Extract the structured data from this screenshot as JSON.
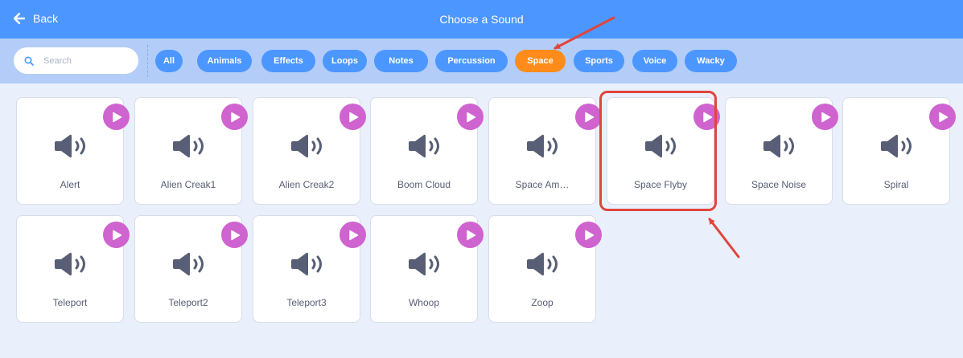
{
  "header": {
    "back_label": "Back",
    "title": "Choose a Sound"
  },
  "search": {
    "placeholder": "Search",
    "value": ""
  },
  "tags": [
    {
      "label": "All",
      "active": false
    },
    {
      "label": "Animals",
      "active": false
    },
    {
      "label": "Effects",
      "active": false
    },
    {
      "label": "Loops",
      "active": false
    },
    {
      "label": "Notes",
      "active": false
    },
    {
      "label": "Percussion",
      "active": false
    },
    {
      "label": "Space",
      "active": true
    },
    {
      "label": "Sports",
      "active": false
    },
    {
      "label": "Voice",
      "active": false
    },
    {
      "label": "Wacky",
      "active": false
    }
  ],
  "sounds": [
    {
      "label": "Alert"
    },
    {
      "label": "Alien Creak1"
    },
    {
      "label": "Alien Creak2"
    },
    {
      "label": "Boom Cloud"
    },
    {
      "label": "Space Am…"
    },
    {
      "label": "Space Flyby",
      "highlighted": true
    },
    {
      "label": "Space Noise"
    },
    {
      "label": "Spiral"
    },
    {
      "label": "Teleport"
    },
    {
      "label": "Teleport2"
    },
    {
      "label": "Teleport3"
    },
    {
      "label": "Whoop"
    },
    {
      "label": "Zoop"
    }
  ],
  "icons": {
    "back": "arrow-left-icon",
    "search": "search-icon",
    "sound": "speaker-icon",
    "play": "play-icon"
  },
  "colors": {
    "header": "#4c97ff",
    "filter_bar": "#b3cdf8",
    "tag": "#4c97ff",
    "tag_active": "#ff8c1a",
    "play_button": "#cf63cf",
    "annotation": "#e0453d",
    "background": "#e9f0fb"
  }
}
